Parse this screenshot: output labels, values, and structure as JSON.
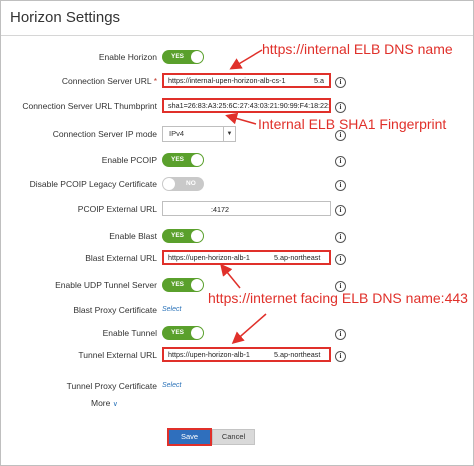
{
  "window": {
    "title": "Horizon Settings"
  },
  "fields": {
    "enable_horizon": {
      "label": "Enable Horizon",
      "state": "YES"
    },
    "connection_server_url": {
      "label": "Connection Server URL",
      "required": "*",
      "value": "https://internal-upen-horizon-alb-cs-1",
      "suffix": "5.a"
    },
    "thumbprint": {
      "label": "Connection Server URL Thumbprint",
      "value": "sha1=26:83:A3:25:6C:27:43:03:21:90:99:F4:18:22:7I"
    },
    "ip_mode": {
      "label": "Connection Server IP mode",
      "value": "IPv4"
    },
    "enable_pcoip": {
      "label": "Enable PCOIP",
      "state": "YES"
    },
    "disable_pcoip_legacy": {
      "label": "Disable PCOIP Legacy Certificate",
      "state": "NO"
    },
    "pcoip_external_url": {
      "label": "PCOIP External URL",
      "value": ":4172"
    },
    "enable_blast": {
      "label": "Enable Blast",
      "state": "YES"
    },
    "blast_external_url": {
      "label": "Blast External URL",
      "value": "https://upen-horizon-alb-1",
      "suffix": "5.ap-northeast"
    },
    "enable_udp": {
      "label": "Enable UDP Tunnel Server",
      "state": "YES"
    },
    "blast_proxy_cert": {
      "label": "Blast Proxy Certificate",
      "link": "Select"
    },
    "enable_tunnel": {
      "label": "Enable Tunnel",
      "state": "YES"
    },
    "tunnel_external_url": {
      "label": "Tunnel External URL",
      "value": "https://upen-horizon-alb-1",
      "suffix": "5.ap-northeast"
    },
    "tunnel_proxy_cert": {
      "label": "Tunnel Proxy Certificate",
      "link": "Select"
    }
  },
  "more": {
    "label": "More",
    "chevron": "chevron-down-icon"
  },
  "buttons": {
    "save": "Save",
    "cancel": "Cancel"
  },
  "annotations": {
    "elb_dns": "https://internal ELB DNS name",
    "sha1": "Internal ELB SHA1 Fingerprint",
    "internet_dns": "https://internet facing ELB DNS name:443"
  },
  "colors": {
    "toggle_on": "#5aa02c",
    "toggle_off": "#c9c9c9",
    "annotation": "#e0302a",
    "save_button": "#2f6fbd",
    "link": "#2b73b9"
  }
}
